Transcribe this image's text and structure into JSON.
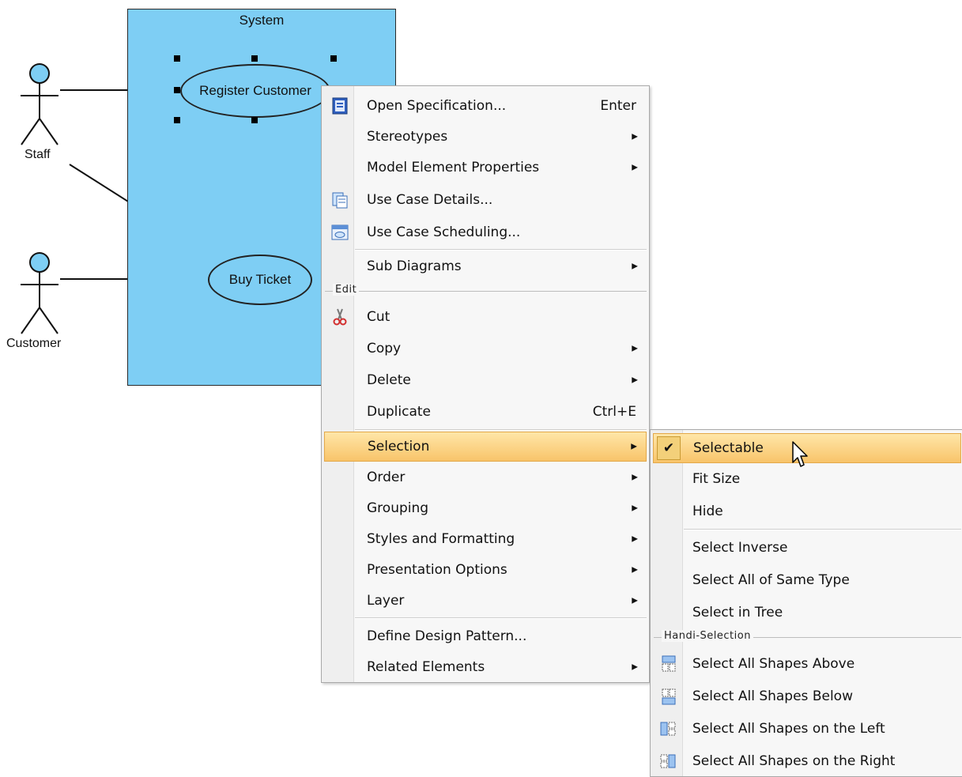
{
  "diagram": {
    "system_title": "System",
    "use_cases": {
      "register_customer": "Register Customer",
      "buy_ticket": "Buy Ticket"
    },
    "actors": {
      "staff": "Staff",
      "customer": "Customer"
    },
    "colors": {
      "fill": "#7ecef4",
      "stroke": "#222222"
    }
  },
  "context_menu": {
    "items": [
      {
        "label": "Open Specification...",
        "shortcut": "Enter",
        "icon": "specification-icon"
      },
      {
        "label": "Stereotypes",
        "submenu": true
      },
      {
        "label": "Model Element Properties",
        "submenu": true
      },
      {
        "label": "Use Case Details...",
        "icon": "use-case-details-icon"
      },
      {
        "label": "Use Case Scheduling...",
        "icon": "use-case-scheduling-icon"
      },
      {
        "label": "Sub Diagrams",
        "submenu": true
      },
      {
        "group": "Edit"
      },
      {
        "label": "Cut",
        "icon": "scissors-icon"
      },
      {
        "label": "Copy",
        "submenu": true
      },
      {
        "label": "Delete",
        "submenu": true
      },
      {
        "label": "Duplicate",
        "shortcut": "Ctrl+E"
      },
      {
        "label": "Selection",
        "submenu": true,
        "highlighted": true
      },
      {
        "label": "Order",
        "submenu": true
      },
      {
        "label": "Grouping",
        "submenu": true
      },
      {
        "label": "Styles and Formatting",
        "submenu": true
      },
      {
        "label": "Presentation Options",
        "submenu": true
      },
      {
        "label": "Layer",
        "submenu": true
      },
      {
        "label": "Define Design Pattern..."
      },
      {
        "label": "Related Elements",
        "submenu": true
      }
    ]
  },
  "selection_submenu": {
    "items": [
      {
        "label": "Selectable",
        "checked": true,
        "highlighted": true
      },
      {
        "label": "Fit Size"
      },
      {
        "label": "Hide"
      },
      {
        "label": "Select Inverse"
      },
      {
        "label": "Select All of Same Type"
      },
      {
        "label": "Select in Tree"
      },
      {
        "group": "Handi-Selection"
      },
      {
        "label": "Select All Shapes Above",
        "icon": "shapes-above-icon"
      },
      {
        "label": "Select All Shapes Below",
        "icon": "shapes-below-icon"
      },
      {
        "label": "Select All Shapes on the Left",
        "icon": "shapes-left-icon"
      },
      {
        "label": "Select All Shapes on the Right",
        "icon": "shapes-right-icon"
      }
    ]
  },
  "colors": {
    "highlight": "#f8c46a",
    "menu_bg": "#f7f7f7"
  }
}
